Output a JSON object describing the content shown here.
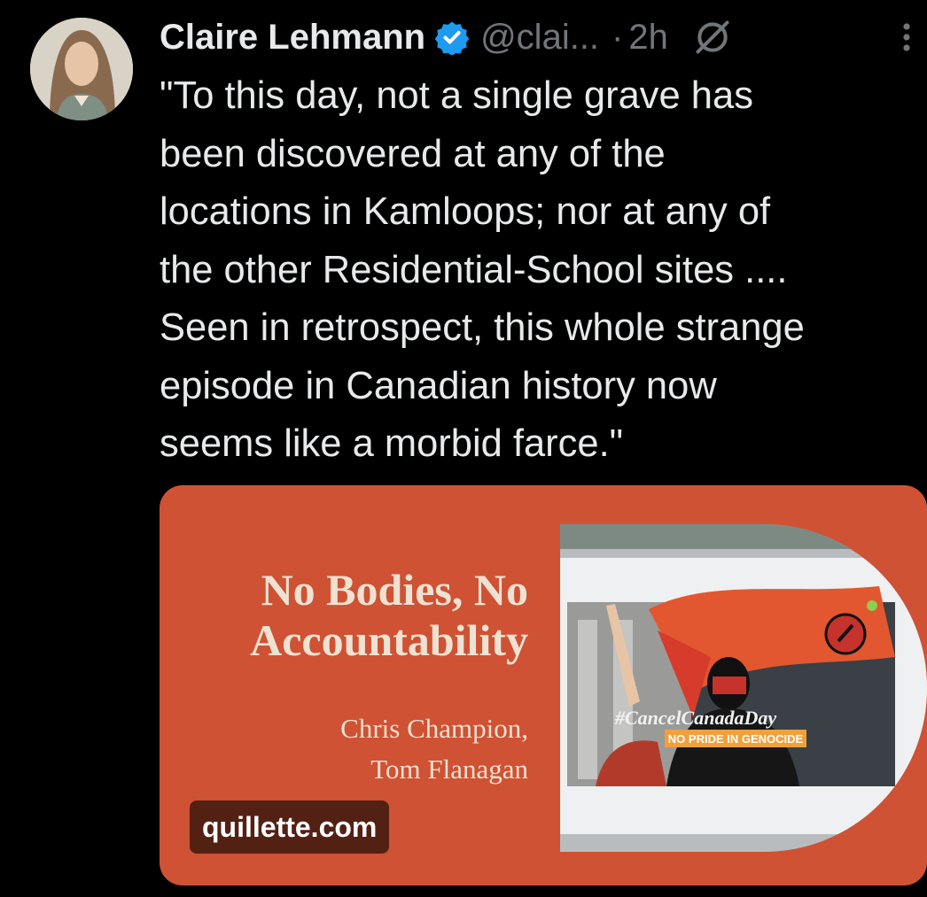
{
  "author": {
    "name": "Claire Lehmann",
    "handle": "@clai...",
    "separator": "·",
    "time": "2h"
  },
  "icons": {
    "verified": "verified-badge-icon",
    "grok": "grok-icon",
    "more": "more-options-icon"
  },
  "tweet": {
    "lines": [
      "\"To this day, not a single grave has",
      "been discovered at any of the",
      "locations in Kamloops; nor at any of",
      "the other Residential-School sites ....",
      "Seen in retrospect, this whole strange",
      "episode in Canadian history now",
      "seems like a morbid farce.\""
    ]
  },
  "card": {
    "title_lines": [
      "No Bodies, No",
      "Accountability"
    ],
    "author_lines": [
      "Chris Champion,",
      "Tom Flanagan"
    ],
    "photo_banner_lines": [
      "#CancelCanadaDay",
      "NO PRIDE IN GENOCIDE"
    ],
    "domain": "quillette.com"
  },
  "colors": {
    "background": "#000000",
    "text": "#e7e9ea",
    "secondary": "#71767b",
    "verified_blue": "#1d9bf0",
    "card_orange": "#cf5234",
    "card_cream": "#efe2d2"
  }
}
